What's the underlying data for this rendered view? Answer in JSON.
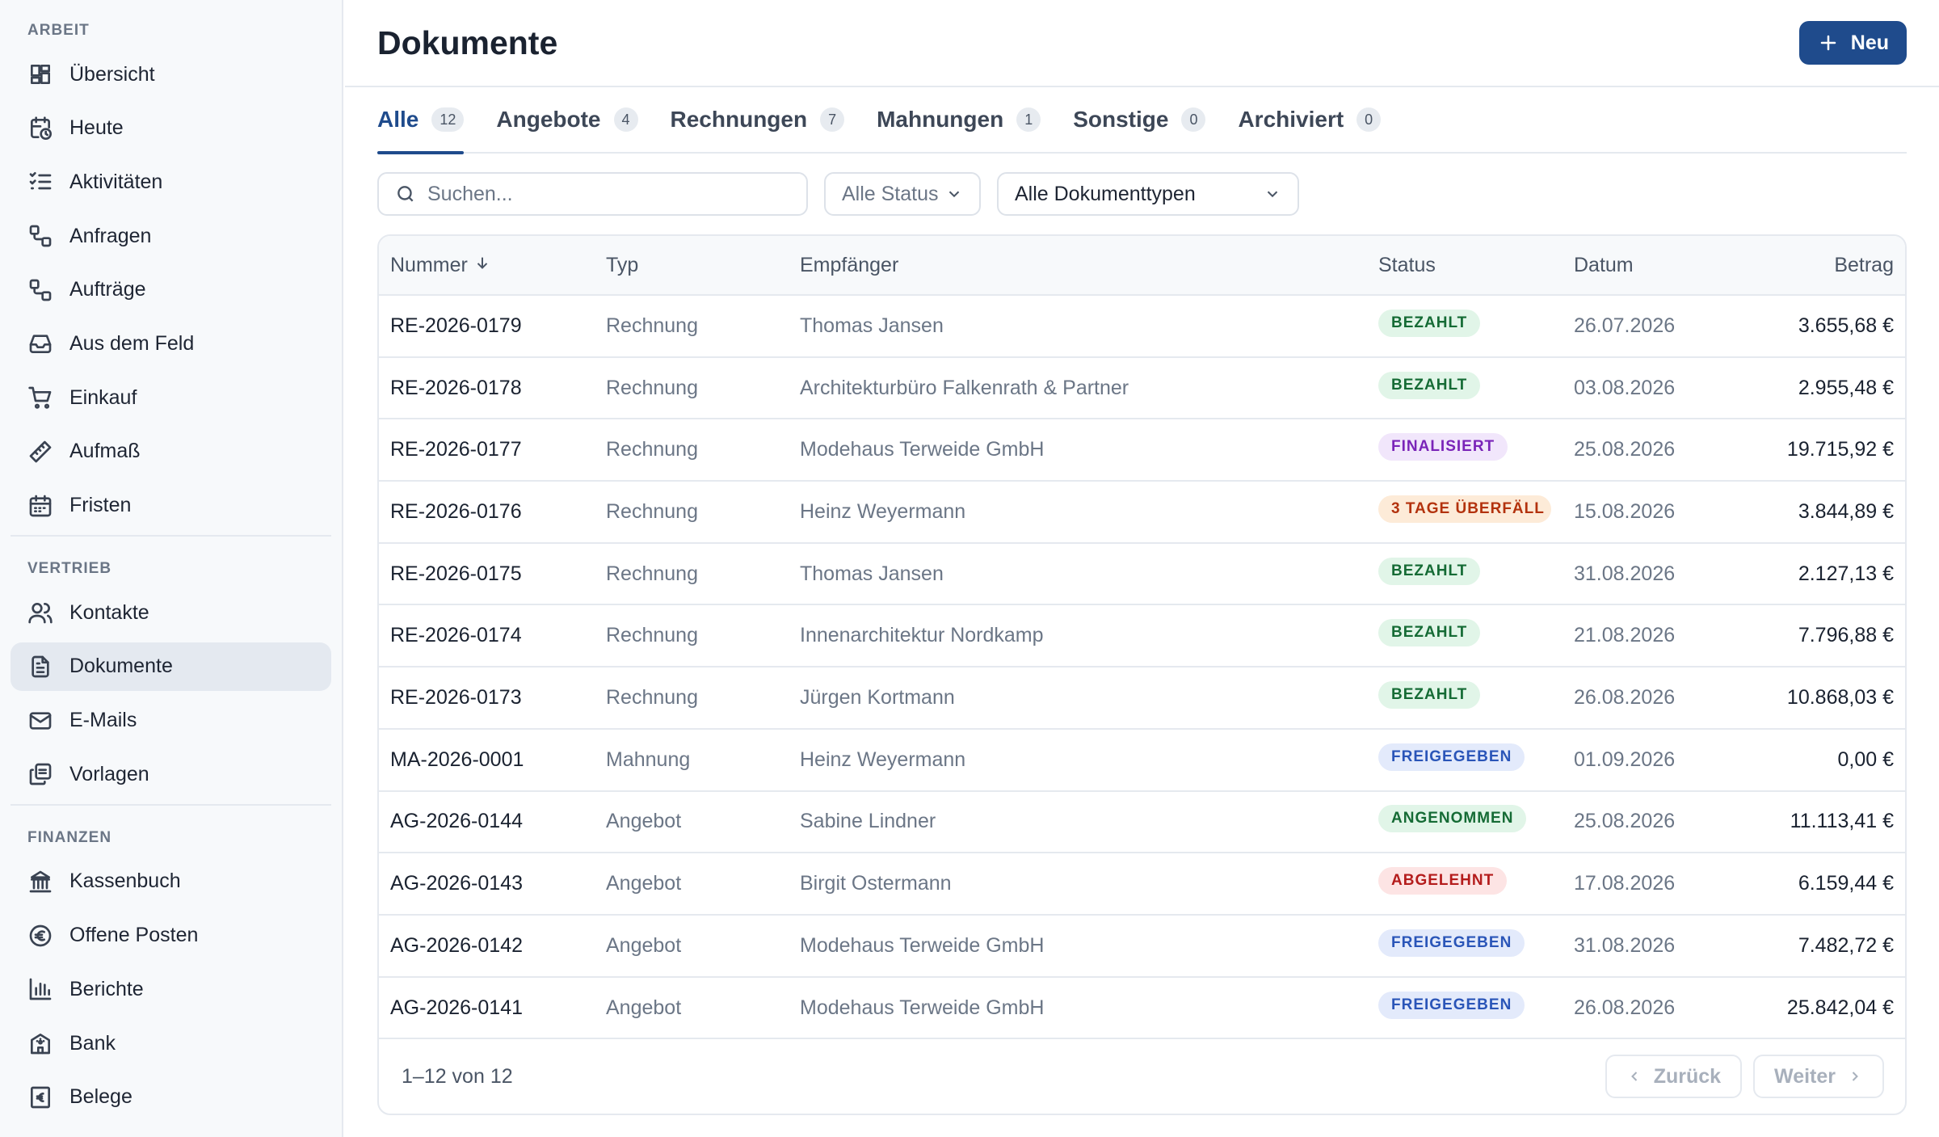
{
  "sidebar": {
    "sections": [
      {
        "label": "ARBEIT",
        "items": [
          {
            "label": "Übersicht",
            "icon": "dashboard-icon"
          },
          {
            "label": "Heute",
            "icon": "calendar-clock-icon"
          },
          {
            "label": "Aktivitäten",
            "icon": "checklist-icon"
          },
          {
            "label": "Anfragen",
            "icon": "workflow-icon"
          },
          {
            "label": "Aufträge",
            "icon": "workflow-icon"
          },
          {
            "label": "Aus dem Feld",
            "icon": "inbox-icon"
          },
          {
            "label": "Einkauf",
            "icon": "cart-icon"
          },
          {
            "label": "Aufmaß",
            "icon": "ruler-icon"
          },
          {
            "label": "Fristen",
            "icon": "calendar-icon"
          }
        ]
      },
      {
        "label": "VERTRIEB",
        "items": [
          {
            "label": "Kontakte",
            "icon": "users-icon"
          },
          {
            "label": "Dokumente",
            "icon": "document-icon",
            "active": true
          },
          {
            "label": "E-Mails",
            "icon": "mail-icon"
          },
          {
            "label": "Vorlagen",
            "icon": "copy-icon"
          }
        ]
      },
      {
        "label": "FINANZEN",
        "items": [
          {
            "label": "Kassenbuch",
            "icon": "landmark-icon"
          },
          {
            "label": "Offene Posten",
            "icon": "euro-circle-icon"
          },
          {
            "label": "Berichte",
            "icon": "bar-chart-icon"
          },
          {
            "label": "Bank",
            "icon": "bank-icon"
          },
          {
            "label": "Belege",
            "icon": "receipt-icon"
          }
        ]
      }
    ]
  },
  "header": {
    "title": "Dokumente",
    "new_button": "Neu"
  },
  "tabs": [
    {
      "label": "Alle",
      "count": "12",
      "active": true
    },
    {
      "label": "Angebote",
      "count": "4"
    },
    {
      "label": "Rechnungen",
      "count": "7"
    },
    {
      "label": "Mahnungen",
      "count": "1"
    },
    {
      "label": "Sonstige",
      "count": "0"
    },
    {
      "label": "Archiviert",
      "count": "0"
    }
  ],
  "filters": {
    "search_placeholder": "Suchen...",
    "status_select": "Alle Status",
    "type_select": "Alle Dokumenttypen"
  },
  "table": {
    "columns": [
      "Nummer",
      "Typ",
      "Empfänger",
      "Status",
      "Datum",
      "Betrag"
    ],
    "rows": [
      {
        "nummer": "RE-2026-0179",
        "typ": "Rechnung",
        "empfaenger": "Thomas Jansen",
        "status": "BEZAHLT",
        "status_color": "#156b35",
        "datum": "26.07.2026",
        "betrag": "3.655,68 €"
      },
      {
        "nummer": "RE-2026-0178",
        "typ": "Rechnung",
        "empfaenger": "Architekturbüro Falkenrath & Partner",
        "status": "BEZAHLT",
        "status_color": "#156b35",
        "datum": "03.08.2026",
        "betrag": "2.955,48 €"
      },
      {
        "nummer": "RE-2026-0177",
        "typ": "Rechnung",
        "empfaenger": "Modehaus Terweide GmbH",
        "status": "FINALISIERT",
        "status_color": "#7a24b8",
        "datum": "25.08.2026",
        "betrag": "19.715,92 €"
      },
      {
        "nummer": "RE-2026-0176",
        "typ": "Rechnung",
        "empfaenger": "Heinz Weyermann",
        "status": "3 TAGE ÜBERFÄLL",
        "status_color": "#b3320d",
        "datum": "15.08.2026",
        "betrag": "3.844,89 €"
      },
      {
        "nummer": "RE-2026-0175",
        "typ": "Rechnung",
        "empfaenger": "Thomas Jansen",
        "status": "BEZAHLT",
        "status_color": "#156b35",
        "datum": "31.08.2026",
        "betrag": "2.127,13 €"
      },
      {
        "nummer": "RE-2026-0174",
        "typ": "Rechnung",
        "empfaenger": "Innenarchitektur Nordkamp",
        "status": "BEZAHLT",
        "status_color": "#156b35",
        "datum": "21.08.2026",
        "betrag": "7.796,88 €"
      },
      {
        "nummer": "RE-2026-0173",
        "typ": "Rechnung",
        "empfaenger": "Jürgen Kortmann",
        "status": "BEZAHLT",
        "status_color": "#156b35",
        "datum": "26.08.2026",
        "betrag": "10.868,03 €"
      },
      {
        "nummer": "MA-2026-0001",
        "typ": "Mahnung",
        "empfaenger": "Heinz Weyermann",
        "status": "FREIGEGEBEN",
        "status_color": "#2a55b8",
        "datum": "01.09.2026",
        "betrag": "0,00 €"
      },
      {
        "nummer": "AG-2026-0144",
        "typ": "Angebot",
        "empfaenger": "Sabine Lindner",
        "status": "ANGENOMMEN",
        "status_color": "#156b35",
        "datum": "25.08.2026",
        "betrag": "11.113,41 €"
      },
      {
        "nummer": "AG-2026-0143",
        "typ": "Angebot",
        "empfaenger": "Birgit Ostermann",
        "status": "ABGELEHNT",
        "status_color": "#b41c1c",
        "datum": "17.08.2026",
        "betrag": "6.159,44 €"
      },
      {
        "nummer": "AG-2026-0142",
        "typ": "Angebot",
        "empfaenger": "Modehaus Terweide GmbH",
        "status": "FREIGEGEBEN",
        "status_color": "#2a55b8",
        "datum": "31.08.2026",
        "betrag": "7.482,72 €"
      },
      {
        "nummer": "AG-2026-0141",
        "typ": "Angebot",
        "empfaenger": "Modehaus Terweide GmbH",
        "status": "FREIGEGEBEN",
        "status_color": "#2a55b8",
        "datum": "26.08.2026",
        "betrag": "25.842,04 €"
      }
    ]
  },
  "footer": {
    "page_info": "1–12 von 12",
    "prev": "Zurück",
    "next": "Weiter"
  },
  "colors": {
    "accent": "#1f4b8c",
    "active_nav_bg": "#e4e9f0"
  }
}
